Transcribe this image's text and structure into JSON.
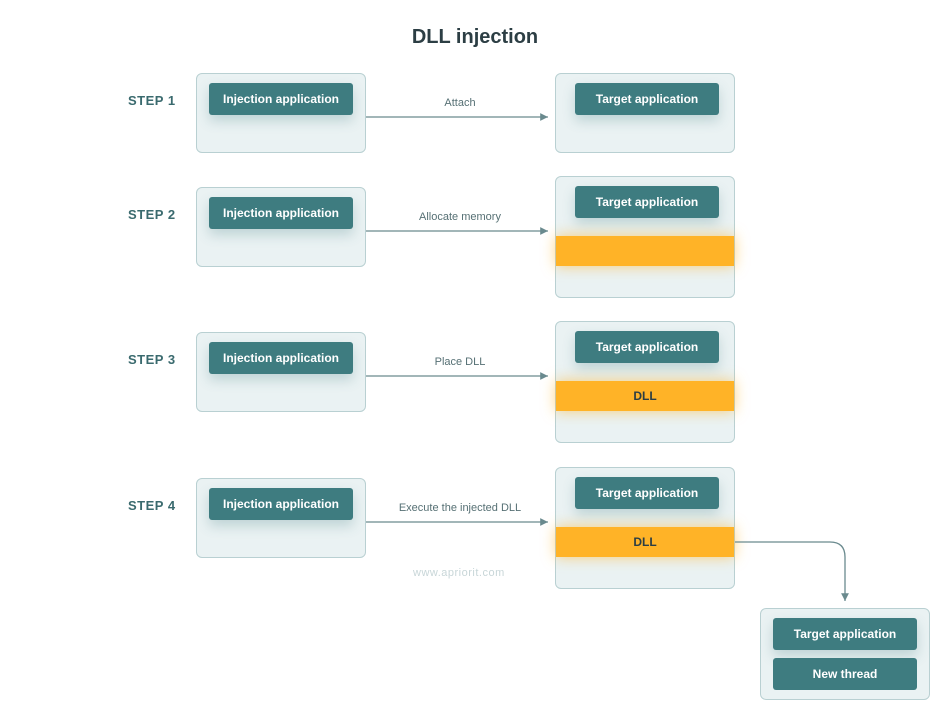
{
  "title": "DLL injection",
  "watermark": "www.apriorit.com",
  "steps": {
    "s1": {
      "label": "STEP 1",
      "left_chip": "Injection application",
      "right_chip": "Target application",
      "arrow": "Attach"
    },
    "s2": {
      "label": "STEP 2",
      "left_chip": "Injection application",
      "right_chip": "Target application",
      "arrow": "Allocate memory"
    },
    "s3": {
      "label": "STEP 3",
      "left_chip": "Injection application",
      "right_chip": "Target application",
      "arrow": "Place DLL",
      "mem_label": "DLL"
    },
    "s4": {
      "label": "STEP 4",
      "left_chip": "Injection application",
      "right_chip": "Target application",
      "arrow": "Execute the injected DLL",
      "mem_label": "DLL",
      "result_top": "Target application",
      "result_bottom": "New thread"
    }
  }
}
